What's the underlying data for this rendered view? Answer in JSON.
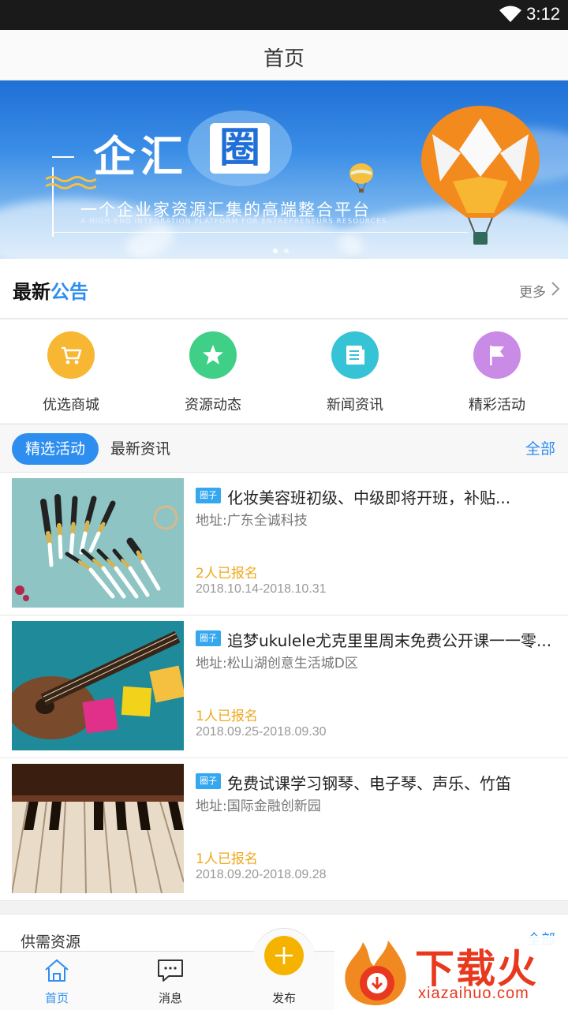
{
  "status_bar": {
    "time": "3:12"
  },
  "header": {
    "title": "首页"
  },
  "banner": {
    "brand_text": "企汇",
    "brand_box": "圈",
    "slogan": "一个企业家资源汇集的高端整合平台",
    "slogan_en": "A HIGH-END INTEGRATION PLATFORM FOR ENTREPRENEURS RESOURCES.",
    "page_count": 2,
    "active_page": 1
  },
  "notice": {
    "label_a": "最新",
    "label_b": "公告",
    "more": "更多"
  },
  "quick_links": [
    {
      "label": "优选商城",
      "icon": "cart-icon",
      "color": "#f7b733"
    },
    {
      "label": "资源动态",
      "icon": "star-icon",
      "color": "#3fcf86"
    },
    {
      "label": "新闻资讯",
      "icon": "news-icon",
      "color": "#36c3d6"
    },
    {
      "label": "精彩活动",
      "icon": "flag-icon",
      "color": "#c98be6"
    }
  ],
  "tabs": {
    "active": "精选活动",
    "other": "最新资讯",
    "all": "全部"
  },
  "activities": [
    {
      "tag": "圈子",
      "title": "化妆美容班初级、中级即将开班，补贴...",
      "address": "地址:广东全诚科技",
      "count": "2人已报名",
      "date": "2018.10.14-2018.10.31",
      "image": "makeup-brushes"
    },
    {
      "tag": "圈子",
      "title": "追梦ukulele尤克里里周末免费公开课一一零...",
      "address": "地址:松山湖创意生活城D区",
      "count": "1人已报名",
      "date": "2018.09.25-2018.09.30",
      "image": "ukulele"
    },
    {
      "tag": "圈子",
      "title": "免费试课学习钢琴、电子琴、声乐、竹笛",
      "address": "地址:国际金融创新园",
      "count": "1人已报名",
      "date": "2018.09.20-2018.09.28",
      "image": "piano-keys"
    }
  ],
  "supply": {
    "label": "供需资源",
    "all": "全部"
  },
  "tabbar": {
    "home": "首页",
    "messages": "消息",
    "publish": "发布"
  },
  "watermark": {
    "cn": "下载火",
    "en": "xiazaihuo.com"
  },
  "colors": {
    "accent": "#2d8ef0",
    "orange": "#f0a81c",
    "publish": "#f5b300"
  }
}
